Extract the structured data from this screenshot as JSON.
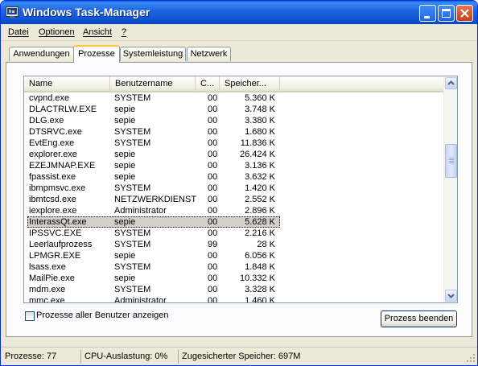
{
  "window": {
    "title": "Windows Task-Manager",
    "controls": {
      "minimize": "minimize-icon",
      "maximize": "maximize-icon",
      "close": "close-icon"
    }
  },
  "menu": [
    "Datei",
    "Optionen",
    "Ansicht",
    "?"
  ],
  "tabs": [
    {
      "label": "Anwendungen",
      "active": false
    },
    {
      "label": "Prozesse",
      "active": true
    },
    {
      "label": "Systemleistung",
      "active": false
    },
    {
      "label": "Netzwerk",
      "active": false
    }
  ],
  "table": {
    "columns": [
      "Name",
      "Benutzername",
      "C...",
      "Speicher..."
    ],
    "rows": [
      {
        "name": "cvpnd.exe",
        "user": "SYSTEM",
        "cpu": "00",
        "mem": "5.360 K"
      },
      {
        "name": "DLACTRLW.EXE",
        "user": "sepie",
        "cpu": "00",
        "mem": "3.748 K"
      },
      {
        "name": "DLG.exe",
        "user": "sepie",
        "cpu": "00",
        "mem": "3.380 K"
      },
      {
        "name": "DTSRVC.exe",
        "user": "SYSTEM",
        "cpu": "00",
        "mem": "1.680 K"
      },
      {
        "name": "EvtEng.exe",
        "user": "SYSTEM",
        "cpu": "00",
        "mem": "11.836 K"
      },
      {
        "name": "explorer.exe",
        "user": "sepie",
        "cpu": "00",
        "mem": "26.424 K"
      },
      {
        "name": "EZEJMNAP.EXE",
        "user": "sepie",
        "cpu": "00",
        "mem": "3.136 K"
      },
      {
        "name": "fpassist.exe",
        "user": "sepie",
        "cpu": "00",
        "mem": "3.632 K"
      },
      {
        "name": "ibmpmsvc.exe",
        "user": "SYSTEM",
        "cpu": "00",
        "mem": "1.420 K"
      },
      {
        "name": "ibmtcsd.exe",
        "user": "NETZWERKDIENST",
        "cpu": "00",
        "mem": "2.552 K"
      },
      {
        "name": "iexplore.exe",
        "user": "Administrator",
        "cpu": "00",
        "mem": "2.896 K"
      },
      {
        "name": "InterassQt.exe",
        "user": "sepie",
        "cpu": "00",
        "mem": "5.628 K",
        "selected": true
      },
      {
        "name": "IPSSVC.EXE",
        "user": "SYSTEM",
        "cpu": "00",
        "mem": "2.216 K"
      },
      {
        "name": "Leerlaufprozess",
        "user": "SYSTEM",
        "cpu": "99",
        "mem": "28 K"
      },
      {
        "name": "LPMGR.EXE",
        "user": "sepie",
        "cpu": "00",
        "mem": "6.056 K"
      },
      {
        "name": "lsass.exe",
        "user": "SYSTEM",
        "cpu": "00",
        "mem": "1.848 K"
      },
      {
        "name": "MailPie.exe",
        "user": "sepie",
        "cpu": "00",
        "mem": "10.332 K"
      },
      {
        "name": "mdm.exe",
        "user": "SYSTEM",
        "cpu": "00",
        "mem": "3.328 K"
      },
      {
        "name": "mmc.exe",
        "user": "Administrator",
        "cpu": "00",
        "mem": "1.460 K"
      }
    ]
  },
  "show_all_users": {
    "label": "Prozesse aller Benutzer anzeigen",
    "checked": false
  },
  "end_process_button": "Prozess beenden",
  "status": {
    "processes": "Prozesse: 77",
    "cpu": "CPU-Auslastung: 0%",
    "commit": "Zugesicherter Speicher: 697M"
  },
  "colors": {
    "titlebar": "#0c52d0",
    "face": "#ece9d8",
    "tab_highlight": "#ffc83c",
    "selection": "#d4d0c8"
  }
}
